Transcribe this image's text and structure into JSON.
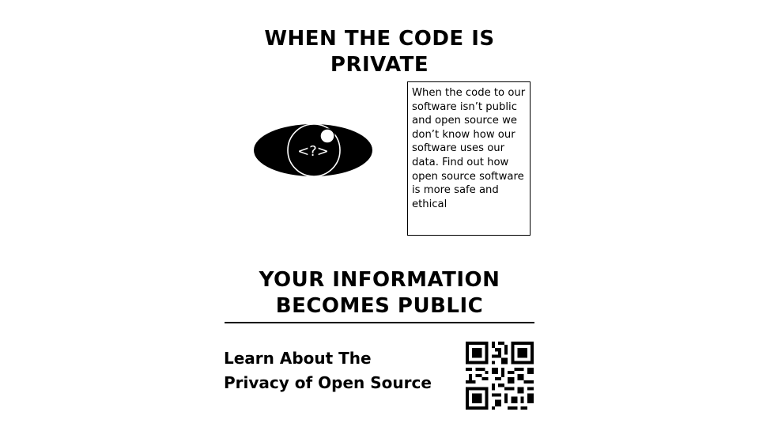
{
  "header": {
    "title": "WHEN THE CODE IS\nPRIVATE"
  },
  "illustration": {
    "eye_icon_text": "<?>"
  },
  "info_box": {
    "text": "When the code to our software isn’t public and open source we don’t know how our software uses our data. Find out how open source software is more safe and ethical"
  },
  "subheader": {
    "title": "YOUR INFORMATION\nBECOMES PUBLIC"
  },
  "cta": {
    "text": "Learn About The\nPrivacy of Open Source"
  },
  "colors": {
    "ink": "#000000",
    "paper": "#ffffff"
  },
  "icons": {
    "eye": "eye-icon",
    "qr": "qr-code-icon"
  }
}
